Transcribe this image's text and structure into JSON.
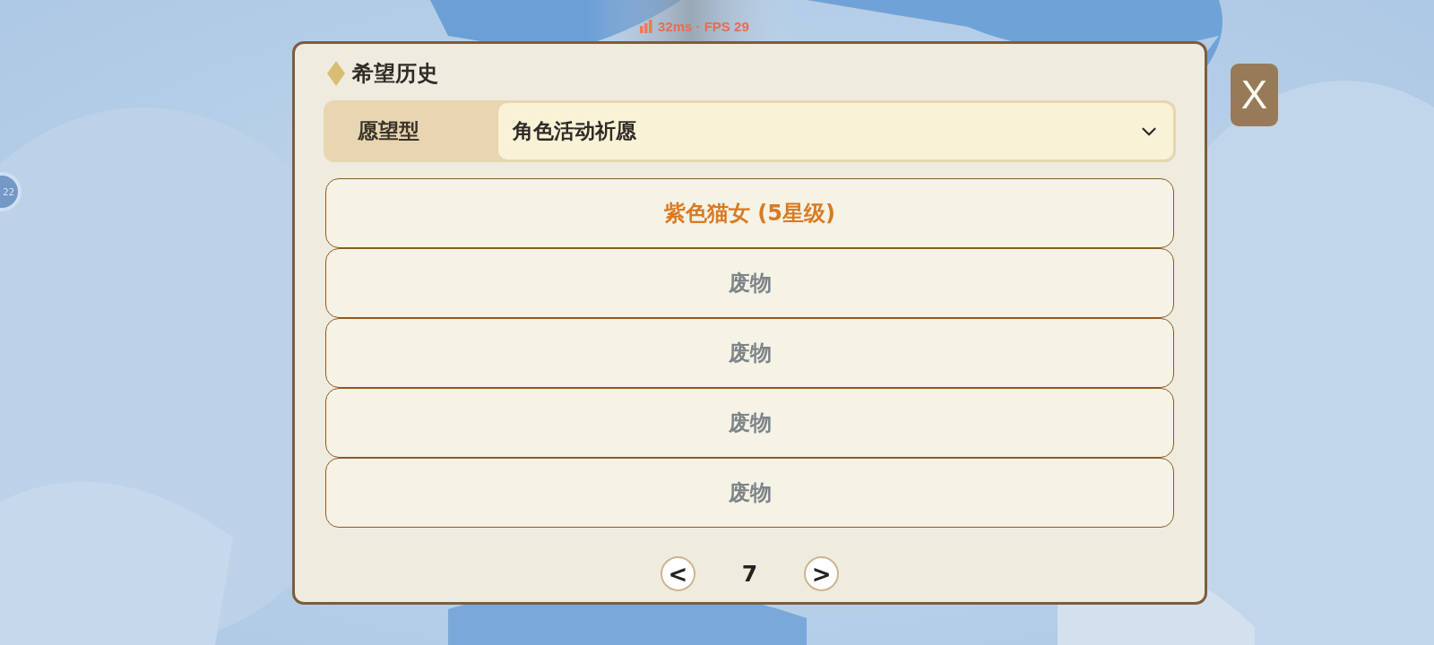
{
  "status_overlay": {
    "text": "32ms · FPS 29"
  },
  "side_badge": {
    "text": "22"
  },
  "dialog": {
    "title": "希望历史",
    "filter": {
      "label": "愿望型",
      "value": "角色活动祈愿"
    },
    "records": [
      {
        "text": "紫色猫女 (5星级)",
        "kind": "rare"
      },
      {
        "text": "废物",
        "kind": "common"
      },
      {
        "text": "废物",
        "kind": "common"
      },
      {
        "text": "废物",
        "kind": "common"
      },
      {
        "text": "废物",
        "kind": "common"
      }
    ],
    "pagination": {
      "prev": "<",
      "page": "7",
      "next": ">"
    }
  },
  "close_button": {
    "label": "X"
  }
}
